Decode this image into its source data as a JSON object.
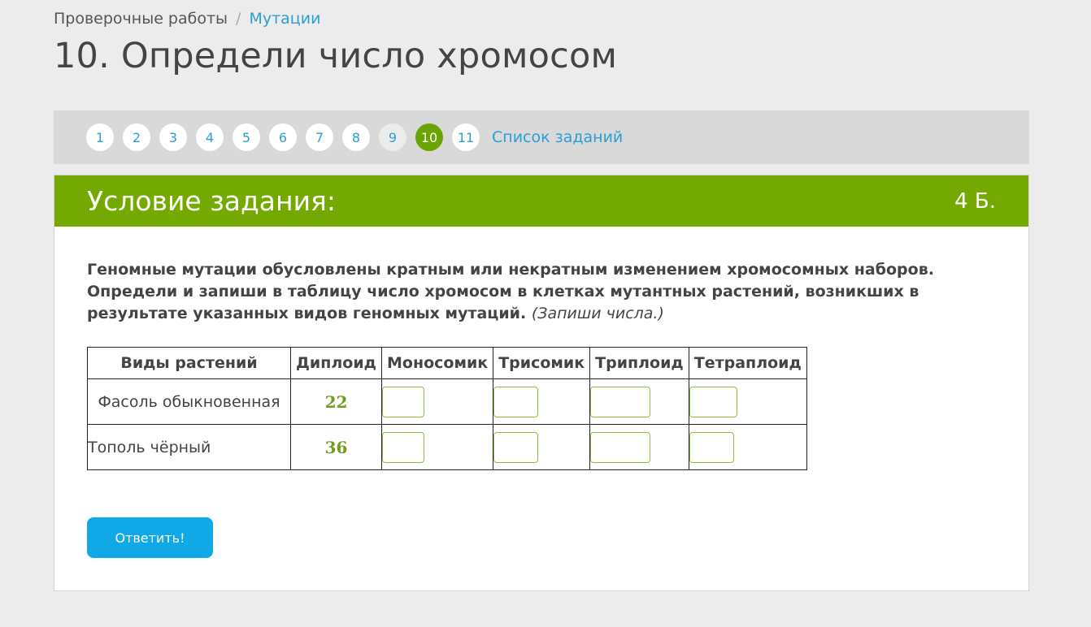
{
  "breadcrumb": {
    "parent": "Проверочные работы",
    "separator": "/",
    "current": "Мутации"
  },
  "page": {
    "title": "10. Определи число хромосом"
  },
  "task_nav": {
    "pills": [
      "1",
      "2",
      "3",
      "4",
      "5",
      "6",
      "7",
      "8",
      "9",
      "10",
      "11"
    ],
    "visited_index": 8,
    "active_index": 9,
    "task_list_label": "Список заданий"
  },
  "card": {
    "header_title": "Условие задания:",
    "points": "4 Б.",
    "task_text": "Геномные мутации обусловлены кратным или некратным изменением хромосомных наборов. Определи и запиши в таблицу число хромосом в клетках мутантных растений, возникших в результате указанных видов геномных мутаций.",
    "hint": "(Запиши числа.)"
  },
  "table": {
    "headers": [
      "Виды растений",
      "Диплоид",
      "Моносомик",
      "Трисомик",
      "Триплоид",
      "Тетраплоид"
    ],
    "rows": [
      {
        "plant": "Фасоль обыкновенная",
        "diploid": "22",
        "monosomic": "",
        "trisomic": "",
        "triploid": "",
        "tetraploid": ""
      },
      {
        "plant": "Тополь чёрный",
        "diploid": "36",
        "monosomic": "",
        "trisomic": "",
        "triploid": "",
        "tetraploid": ""
      }
    ]
  },
  "submit_label": "Ответить!",
  "colors": {
    "accent_green": "#74aa00",
    "active_pill": "#6aa400",
    "link_blue": "#2a9fd6",
    "button_blue": "#0fa9e8"
  }
}
